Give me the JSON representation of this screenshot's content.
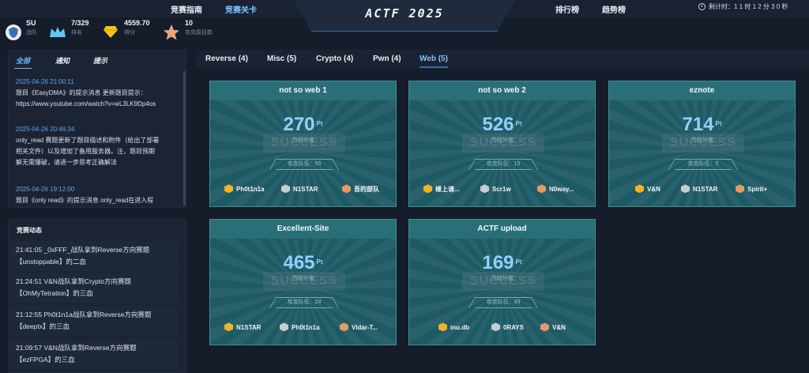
{
  "header": {
    "nav_left": [
      "竞赛指南",
      "竞赛关卡"
    ],
    "active_nav": "竞赛关卡",
    "title": "ACTF 2025",
    "nav_right": [
      "排行榜",
      "趋势榜"
    ],
    "timer_label": "剩计时：",
    "timer_value": "1 1 时 1 2 分 3 0 秒"
  },
  "stats": {
    "team_name": "SU",
    "team_label": "战队",
    "rank_value": "7/329",
    "rank_label": "排名",
    "score_value": "4559.70",
    "score_label": "得分",
    "solved_value": "10",
    "solved_label": "攻克题目数"
  },
  "notices": {
    "tabs": [
      "全部",
      "通知",
      "提示"
    ],
    "active_tab": "全部",
    "items": [
      {
        "time": "2025-04-26 21:00:11",
        "lines": [
          "题目《EasyDMA》的提示消息 更新题目提示：",
          "https://www.youtube.com/watch?v=wL3LK9Dp4os"
        ]
      },
      {
        "time": "2025-04-26 20:46:34",
        "lines": [
          "only_read 赛题更新了题目描述和附件（给出了部署",
          "相关文件）以及增加了备用服务器。注，题目预期",
          "解无需爆破，请进一步思考正确解法"
        ]
      },
      {
        "time": "2025-04-26 19:12:00",
        "lines": [
          "题目《only read》的提示消息 only_read在进入程"
        ]
      }
    ]
  },
  "dynamics": {
    "title": "竞赛动态",
    "items": [
      {
        "line1": "21:41:05 _0xFFF_战队拿到Reverse方向赛题",
        "line2": "【unstoppable】的二血"
      },
      {
        "line1": "21:24:51 V&N战队拿到Crypto方向赛题",
        "line2": "【OhMyTetration】的三血"
      },
      {
        "line1": "21:12:55 Ph0t1n1a战队拿到Reverse方向赛题",
        "line2": "【deeptx】的三血"
      },
      {
        "line1": "21:09:57 V&N战队拿到Reverse方向赛题",
        "line2": "【ezFPGA】的三血"
      }
    ]
  },
  "categories": {
    "tabs": [
      "Reverse (4)",
      "Misc (5)",
      "Crypto (4)",
      "Pwn (4)",
      "Web (5)"
    ],
    "active": "Web (5)"
  },
  "card_common": {
    "pt_label": "Pt",
    "current_score_label": "当前分值",
    "stamp_text": "SUCCESS"
  },
  "challenges": [
    {
      "name": "not so web 1",
      "score": "270",
      "solves": "攻克队伍：55",
      "bloods": [
        "Ph0t1n1a",
        "N1STAR",
        "吾的部队"
      ]
    },
    {
      "name": "not so web 2",
      "score": "526",
      "solves": "攻克队伍：15",
      "bloods": [
        "楼上请...",
        "Scr1w",
        "N0way..."
      ]
    },
    {
      "name": "eznote",
      "score": "714",
      "solves": "攻克队伍：5",
      "bloods": [
        "V&N",
        "N1STAR",
        "Spirit+"
      ]
    },
    {
      "name": "Excellent-Site",
      "score": "465",
      "solves": "攻克队伍：24",
      "bloods": [
        "N1STAR",
        "Ph0t1n1a",
        "Vidar-T..."
      ]
    },
    {
      "name": "ACTF upload",
      "score": "169",
      "solves": "攻克队伍：99",
      "bloods": [
        "inu.db",
        "0RAYS",
        "V&N"
      ]
    }
  ],
  "colors": {
    "accent": "#7fc6ff",
    "card_bg": "#1e5a64",
    "gold": "#f0b428",
    "silver": "#c7ccd3",
    "bronze": "#e39a66"
  }
}
